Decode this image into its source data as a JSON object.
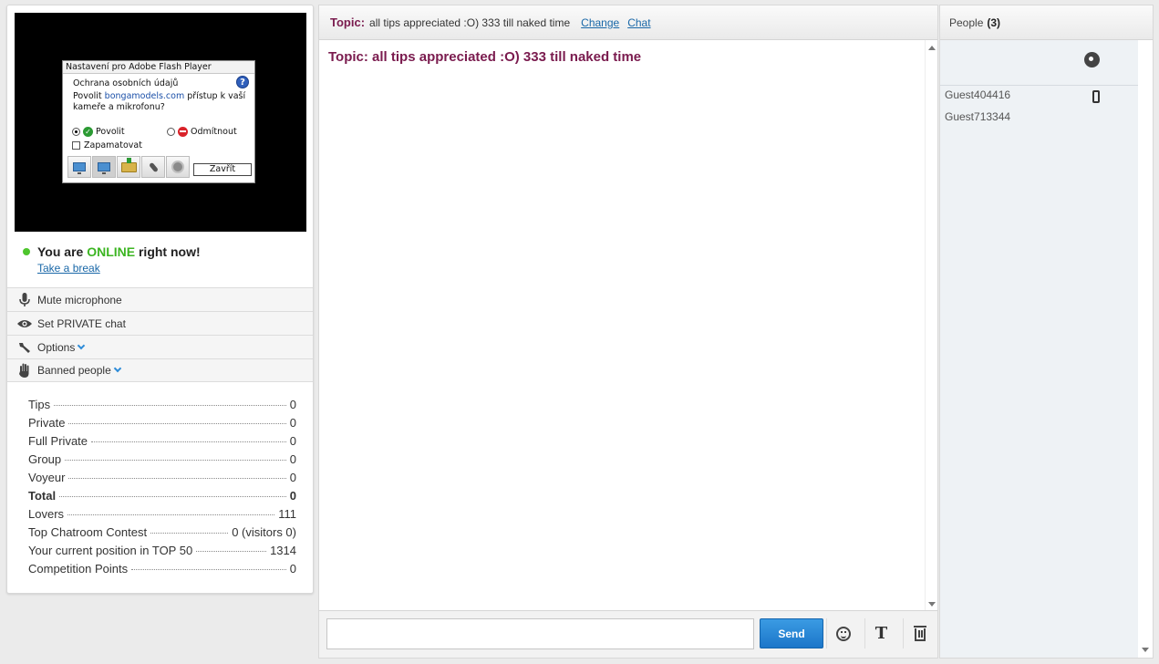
{
  "flash_dialog": {
    "title": "Nastavení pro Adobe Flash Player",
    "heading": "Ochrana osobních údajů",
    "question_prefix": "Povolit",
    "question_domain": "bongamodels.com",
    "question_suffix": "přístup k vaší kameře a mikrofonu?",
    "allow_label": "Povolit",
    "deny_label": "Odmítnout",
    "remember_label": "Zapamatovat",
    "close_label": "Zavřít",
    "help": "?"
  },
  "status": {
    "prefix": "You are",
    "state": "ONLINE",
    "suffix": "right now!",
    "break_link": "Take a break"
  },
  "menu": {
    "mute": "Mute microphone",
    "private": "Set PRIVATE chat",
    "options": "Options",
    "banned": "Banned people"
  },
  "stats": [
    {
      "label": "Tips",
      "value": "0"
    },
    {
      "label": "Private",
      "value": "0"
    },
    {
      "label": "Full Private",
      "value": "0"
    },
    {
      "label": "Group",
      "value": "0"
    },
    {
      "label": "Voyeur",
      "value": "0"
    },
    {
      "label": "Total",
      "value": "0"
    },
    {
      "label": "Lovers",
      "value": "111"
    },
    {
      "label": "Top Chatroom Contest",
      "value": "0 (visitors 0)"
    },
    {
      "label": "Your current position in TOP 50",
      "value": "1314"
    },
    {
      "label": "Competition Points",
      "value": "0"
    }
  ],
  "topic_bar": {
    "label": "Topic:",
    "text": "all tips appreciated :O) 333 till naked time",
    "change_link": "Change",
    "chat_link": "Chat"
  },
  "chat": {
    "topic_message": "Topic: all tips appreciated :O) 333 till naked time",
    "input_value": "",
    "send_label": "Send",
    "font_glyph": "T"
  },
  "people": {
    "label": "People",
    "count": "(3)",
    "list": [
      "Guest404416",
      "Guest713344"
    ]
  }
}
